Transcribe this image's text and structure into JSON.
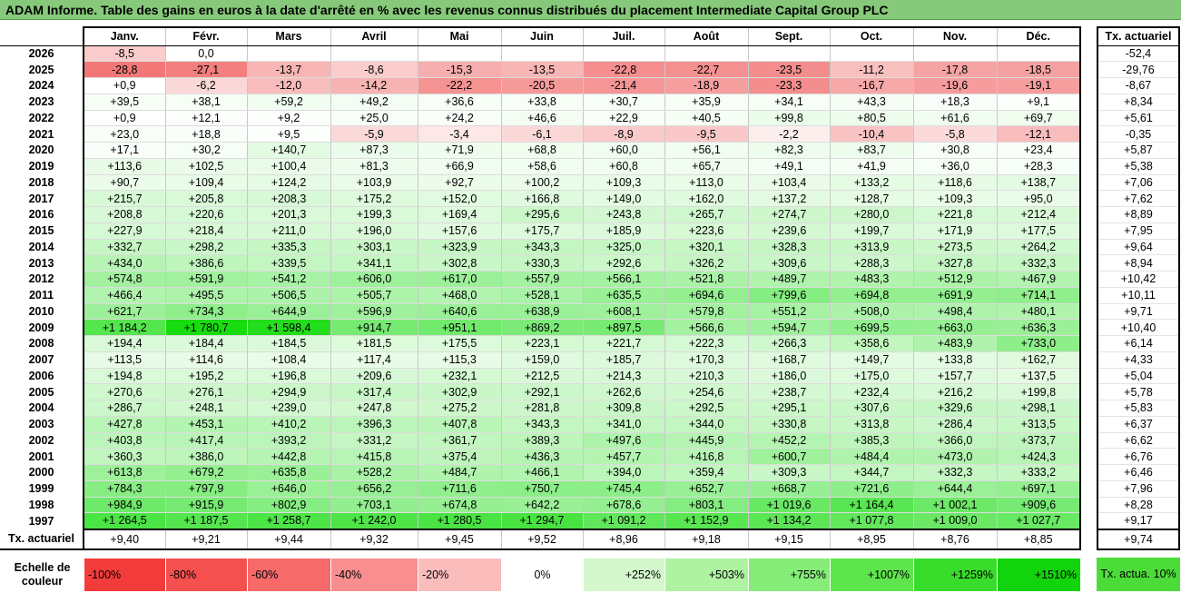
{
  "title": "ADAM Informe. Table des gains en euros à la date d'arrêté en % avec les revenus connus distribués du placement Intermediate Capital Group PLC",
  "months": [
    "Janv.",
    "Févr.",
    "Mars",
    "Avril",
    "Mai",
    "Juin",
    "Juil.",
    "Août",
    "Sept.",
    "Oct.",
    "Nov.",
    "Déc."
  ],
  "side_header": "Tx. actuariel",
  "rows": [
    {
      "year": "2026",
      "cells": [
        "-8,5",
        "0,0",
        "",
        "",
        "",
        "",
        "",
        "",
        "",
        "",
        "",
        ""
      ],
      "tx": "-52,4"
    },
    {
      "year": "2025",
      "cells": [
        "-28,8",
        "-27,1",
        "-13,7",
        "-8,6",
        "-15,3",
        "-13,5",
        "-22,8",
        "-22,7",
        "-23,5",
        "-11,2",
        "-17,8",
        "-18,5"
      ],
      "tx": "-29,76"
    },
    {
      "year": "2024",
      "cells": [
        "+0,9",
        "-6,2",
        "-12,0",
        "-14,2",
        "-22,2",
        "-20,5",
        "-21,4",
        "-18,9",
        "-23,3",
        "-16,7",
        "-19,6",
        "-19,1"
      ],
      "tx": "-8,67"
    },
    {
      "year": "2023",
      "cells": [
        "+39,5",
        "+38,1",
        "+59,2",
        "+49,2",
        "+36,6",
        "+33,8",
        "+30,7",
        "+35,9",
        "+34,1",
        "+43,3",
        "+18,3",
        "+9,1"
      ],
      "tx": "+8,34"
    },
    {
      "year": "2022",
      "cells": [
        "+0,9",
        "+12,1",
        "+9,2",
        "+25,0",
        "+24,2",
        "+46,6",
        "+22,9",
        "+40,5",
        "+99,8",
        "+80,5",
        "+61,6",
        "+69,7"
      ],
      "tx": "+5,61"
    },
    {
      "year": "2021",
      "cells": [
        "+23,0",
        "+18,8",
        "+9,5",
        "-5,9",
        "-3,4",
        "-6,1",
        "-8,9",
        "-9,5",
        "-2,2",
        "-10,4",
        "-5,8",
        "-12,1"
      ],
      "tx": "-0,35"
    },
    {
      "year": "2020",
      "cells": [
        "+17,1",
        "+30,2",
        "+140,7",
        "+87,3",
        "+71,9",
        "+68,8",
        "+60,0",
        "+56,1",
        "+82,3",
        "+83,7",
        "+30,8",
        "+23,4"
      ],
      "tx": "+5,87"
    },
    {
      "year": "2019",
      "cells": [
        "+113,6",
        "+102,5",
        "+100,4",
        "+81,3",
        "+66,9",
        "+58,6",
        "+60,8",
        "+65,7",
        "+49,1",
        "+41,9",
        "+36,0",
        "+28,3"
      ],
      "tx": "+5,38"
    },
    {
      "year": "2018",
      "cells": [
        "+90,7",
        "+109,4",
        "+124,2",
        "+103,9",
        "+92,7",
        "+100,2",
        "+109,3",
        "+113,0",
        "+103,4",
        "+133,2",
        "+118,6",
        "+138,7"
      ],
      "tx": "+7,06"
    },
    {
      "year": "2017",
      "cells": [
        "+215,7",
        "+205,8",
        "+208,3",
        "+175,2",
        "+152,0",
        "+166,8",
        "+149,0",
        "+162,0",
        "+137,2",
        "+128,7",
        "+109,3",
        "+95,0"
      ],
      "tx": "+7,62"
    },
    {
      "year": "2016",
      "cells": [
        "+208,8",
        "+220,6",
        "+201,3",
        "+199,3",
        "+169,4",
        "+295,6",
        "+243,8",
        "+265,7",
        "+274,7",
        "+280,0",
        "+221,8",
        "+212,4"
      ],
      "tx": "+8,89"
    },
    {
      "year": "2015",
      "cells": [
        "+227,9",
        "+218,4",
        "+211,0",
        "+196,0",
        "+157,6",
        "+175,7",
        "+185,9",
        "+223,6",
        "+239,6",
        "+199,7",
        "+171,9",
        "+177,5"
      ],
      "tx": "+7,95"
    },
    {
      "year": "2014",
      "cells": [
        "+332,7",
        "+298,2",
        "+335,3",
        "+303,1",
        "+323,9",
        "+343,3",
        "+325,0",
        "+320,1",
        "+328,3",
        "+313,9",
        "+273,5",
        "+264,2"
      ],
      "tx": "+9,64"
    },
    {
      "year": "2013",
      "cells": [
        "+434,0",
        "+386,6",
        "+339,5",
        "+341,1",
        "+302,8",
        "+330,3",
        "+292,6",
        "+326,2",
        "+309,6",
        "+288,3",
        "+327,8",
        "+332,3"
      ],
      "tx": "+8,94"
    },
    {
      "year": "2012",
      "cells": [
        "+574,8",
        "+591,9",
        "+541,2",
        "+606,0",
        "+617,0",
        "+557,9",
        "+566,1",
        "+521,8",
        "+489,7",
        "+483,3",
        "+512,9",
        "+467,9"
      ],
      "tx": "+10,42"
    },
    {
      "year": "2011",
      "cells": [
        "+466,4",
        "+495,5",
        "+506,5",
        "+505,7",
        "+468,0",
        "+528,1",
        "+635,5",
        "+694,6",
        "+799,6",
        "+694,8",
        "+691,9",
        "+714,1"
      ],
      "tx": "+10,11"
    },
    {
      "year": "2010",
      "cells": [
        "+621,7",
        "+734,3",
        "+644,9",
        "+596,9",
        "+640,6",
        "+638,9",
        "+608,1",
        "+579,8",
        "+551,2",
        "+508,0",
        "+498,4",
        "+480,1"
      ],
      "tx": "+9,71"
    },
    {
      "year": "2009",
      "cells": [
        "+1 184,2",
        "+1 780,7",
        "+1 598,4",
        "+914,7",
        "+951,1",
        "+869,2",
        "+897,5",
        "+566,6",
        "+594,7",
        "+699,5",
        "+663,0",
        "+636,3"
      ],
      "tx": "+10,40"
    },
    {
      "year": "2008",
      "cells": [
        "+194,4",
        "+184,4",
        "+184,5",
        "+181,5",
        "+175,5",
        "+223,1",
        "+221,7",
        "+222,3",
        "+266,3",
        "+358,6",
        "+483,9",
        "+733,0"
      ],
      "tx": "+6,14"
    },
    {
      "year": "2007",
      "cells": [
        "+113,5",
        "+114,6",
        "+108,4",
        "+117,4",
        "+115,3",
        "+159,0",
        "+185,7",
        "+170,3",
        "+168,7",
        "+149,7",
        "+133,8",
        "+162,7"
      ],
      "tx": "+4,33"
    },
    {
      "year": "2006",
      "cells": [
        "+194,8",
        "+195,2",
        "+196,8",
        "+209,6",
        "+232,1",
        "+212,5",
        "+214,3",
        "+210,3",
        "+186,0",
        "+175,0",
        "+157,7",
        "+137,5"
      ],
      "tx": "+5,04"
    },
    {
      "year": "2005",
      "cells": [
        "+270,6",
        "+276,1",
        "+294,9",
        "+317,4",
        "+302,9",
        "+292,1",
        "+262,6",
        "+254,6",
        "+238,7",
        "+232,4",
        "+216,2",
        "+199,8"
      ],
      "tx": "+5,78"
    },
    {
      "year": "2004",
      "cells": [
        "+286,7",
        "+248,1",
        "+239,0",
        "+247,8",
        "+275,2",
        "+281,8",
        "+309,8",
        "+292,5",
        "+295,1",
        "+307,6",
        "+329,6",
        "+298,1"
      ],
      "tx": "+5,83"
    },
    {
      "year": "2003",
      "cells": [
        "+427,8",
        "+453,1",
        "+410,2",
        "+396,3",
        "+407,8",
        "+343,3",
        "+341,0",
        "+344,0",
        "+330,8",
        "+313,8",
        "+286,4",
        "+313,5"
      ],
      "tx": "+6,37"
    },
    {
      "year": "2002",
      "cells": [
        "+403,8",
        "+417,4",
        "+393,2",
        "+331,2",
        "+361,7",
        "+389,3",
        "+497,6",
        "+445,9",
        "+452,2",
        "+385,3",
        "+366,0",
        "+373,7"
      ],
      "tx": "+6,62"
    },
    {
      "year": "2001",
      "cells": [
        "+360,3",
        "+386,0",
        "+442,8",
        "+415,8",
        "+375,4",
        "+436,3",
        "+457,7",
        "+416,8",
        "+600,7",
        "+484,4",
        "+473,0",
        "+424,3"
      ],
      "tx": "+6,76"
    },
    {
      "year": "2000",
      "cells": [
        "+613,8",
        "+679,2",
        "+635,8",
        "+528,2",
        "+484,7",
        "+466,1",
        "+394,0",
        "+359,4",
        "+309,3",
        "+344,7",
        "+332,3",
        "+333,2"
      ],
      "tx": "+6,46"
    },
    {
      "year": "1999",
      "cells": [
        "+784,3",
        "+797,9",
        "+646,0",
        "+656,2",
        "+711,6",
        "+750,7",
        "+745,4",
        "+652,7",
        "+668,7",
        "+721,6",
        "+644,4",
        "+697,1"
      ],
      "tx": "+7,96"
    },
    {
      "year": "1998",
      "cells": [
        "+984,9",
        "+915,9",
        "+802,9",
        "+703,1",
        "+674,8",
        "+642,2",
        "+678,6",
        "+803,1",
        "+1 019,6",
        "+1 164,4",
        "+1 002,1",
        "+909,6"
      ],
      "tx": "+8,28"
    },
    {
      "year": "1997",
      "cells": [
        "+1 264,5",
        "+1 187,5",
        "+1 258,7",
        "+1 242,0",
        "+1 280,5",
        "+1 294,7",
        "+1 091,2",
        "+1 152,9",
        "+1 134,2",
        "+1 077,8",
        "+1 009,0",
        "+1 027,7"
      ],
      "tx": "+9,17"
    }
  ],
  "summary": {
    "label": "Tx. actuariel",
    "cells": [
      "+9,40",
      "+9,21",
      "+9,44",
      "+9,32",
      "+9,45",
      "+9,52",
      "+8,96",
      "+9,18",
      "+9,15",
      "+8,95",
      "+8,76",
      "+8,85"
    ],
    "tx": "+9,74"
  },
  "scale": {
    "label": "Echelle de couleur",
    "items": [
      {
        "text": "-100%",
        "color": "#f23c3c",
        "align": "left"
      },
      {
        "text": "-80%",
        "color": "#f45050",
        "align": "left"
      },
      {
        "text": "-60%",
        "color": "#f66a6a",
        "align": "left"
      },
      {
        "text": "-40%",
        "color": "#f88e8e",
        "align": "left"
      },
      {
        "text": "-20%",
        "color": "#fbbcbc",
        "align": "left"
      },
      {
        "text": "0%",
        "color": "#ffffff",
        "align": "center"
      },
      {
        "text": "+252%",
        "color": "#d4f8cc",
        "align": "right"
      },
      {
        "text": "+503%",
        "color": "#aef2a2",
        "align": "right"
      },
      {
        "text": "+755%",
        "color": "#86ec78",
        "align": "right"
      },
      {
        "text": "+1007%",
        "color": "#5ee44c",
        "align": "right"
      },
      {
        "text": "+1259%",
        "color": "#38dc2a",
        "align": "right"
      },
      {
        "text": "+1510%",
        "color": "#12d40c",
        "align": "right"
      }
    ],
    "side_label": "Tx. actua. 10%"
  }
}
